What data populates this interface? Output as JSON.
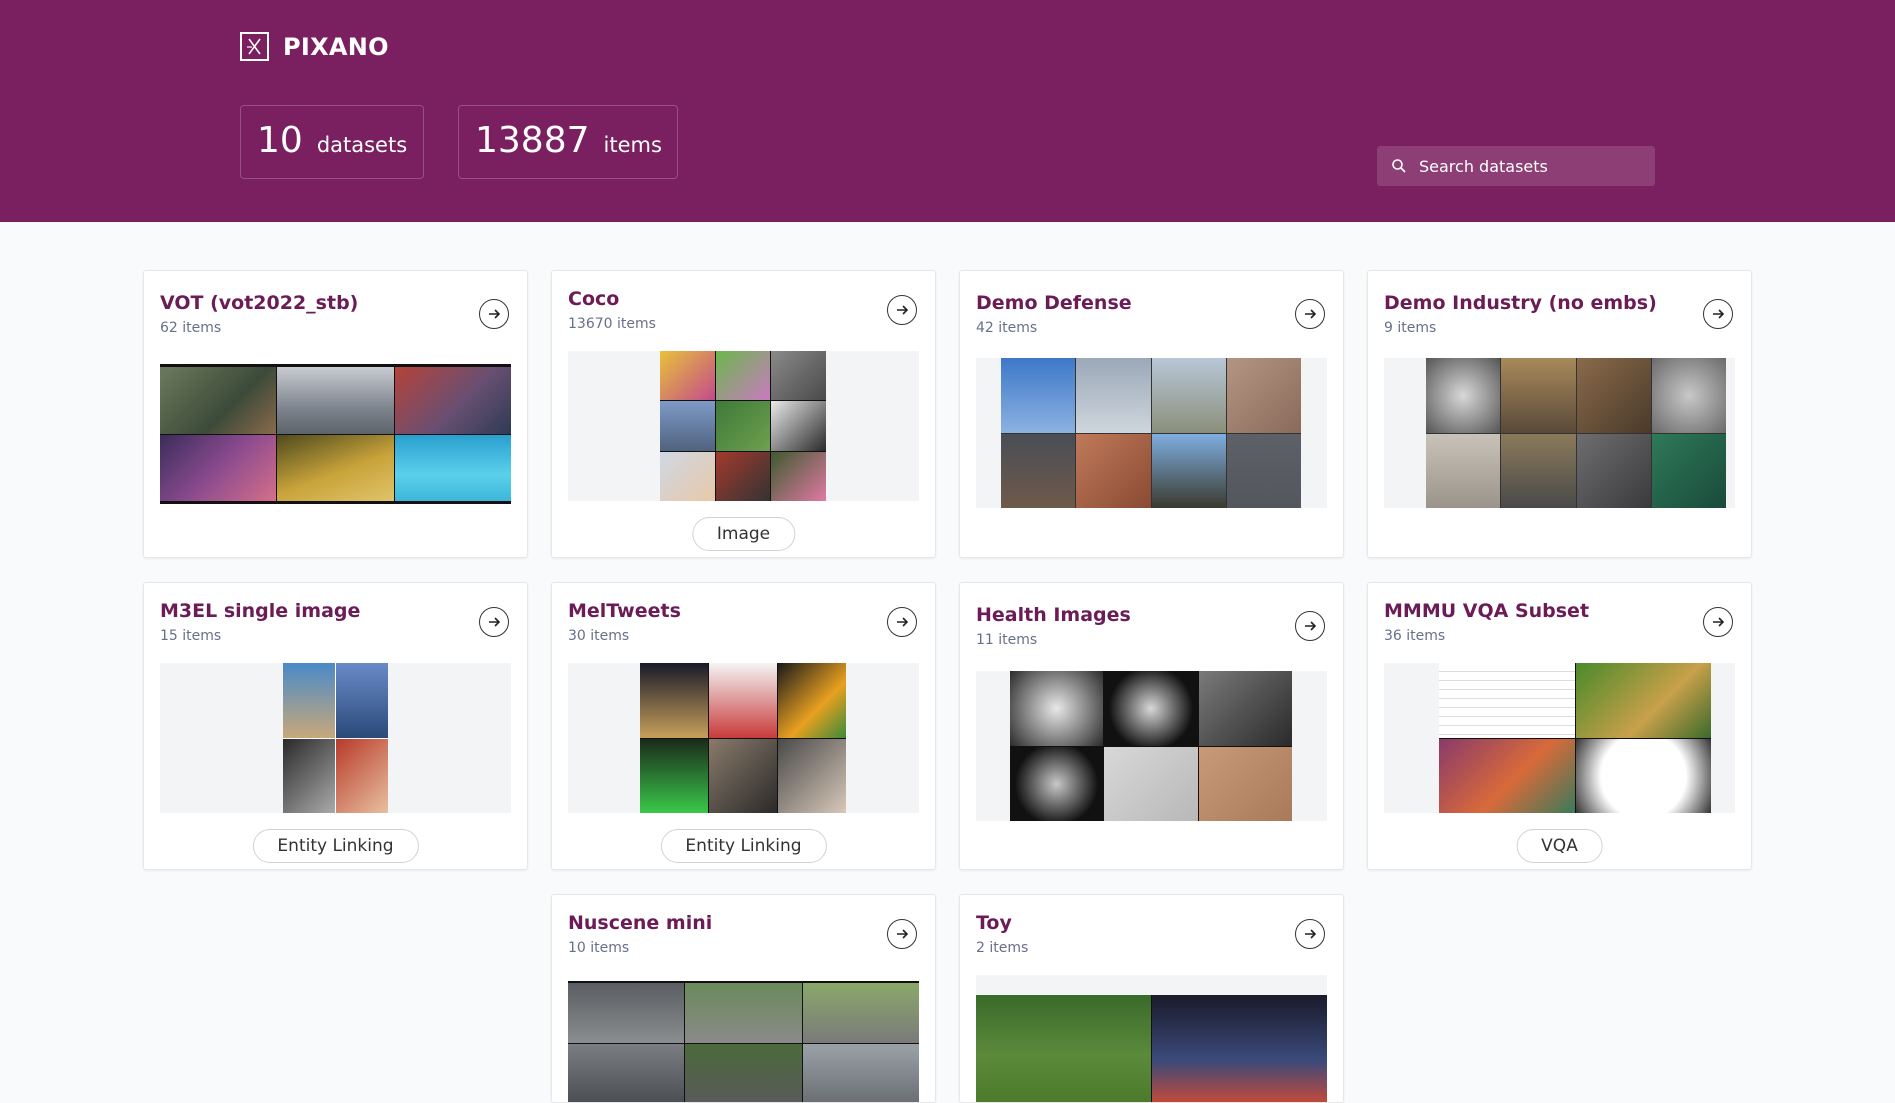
{
  "app": {
    "name": "PIXANO"
  },
  "stats": {
    "datasets_count": "10",
    "datasets_label": "datasets",
    "items_count": "13887",
    "items_label": "items"
  },
  "search": {
    "placeholder": "Search datasets"
  },
  "datasets": [
    {
      "name": "VOT (vot2022_stb)",
      "count": "62 items",
      "badge": ""
    },
    {
      "name": "Coco",
      "count": "13670 items",
      "badge": "Image"
    },
    {
      "name": "Demo Defense",
      "count": "42 items",
      "badge": ""
    },
    {
      "name": "Demo Industry (no embs)",
      "count": "9 items",
      "badge": ""
    },
    {
      "name": "M3EL single image",
      "count": "15 items",
      "badge": "Entity Linking"
    },
    {
      "name": "MelTweets",
      "count": "30 items",
      "badge": "Entity Linking"
    },
    {
      "name": "Health Images",
      "count": "11 items",
      "badge": ""
    },
    {
      "name": "MMMU VQA Subset",
      "count": "36 items",
      "badge": "VQA"
    },
    {
      "name": "Nuscene mini",
      "count": "10 items",
      "badge": ""
    },
    {
      "name": "Toy",
      "count": "2 items",
      "badge": ""
    }
  ],
  "colors": {
    "brand": "#7a1f5f",
    "title": "#6b1c56",
    "background": "#f9fafb"
  },
  "icons": {
    "logo": "pixano-logo-icon",
    "search": "search-icon",
    "open": "arrow-right-icon"
  }
}
